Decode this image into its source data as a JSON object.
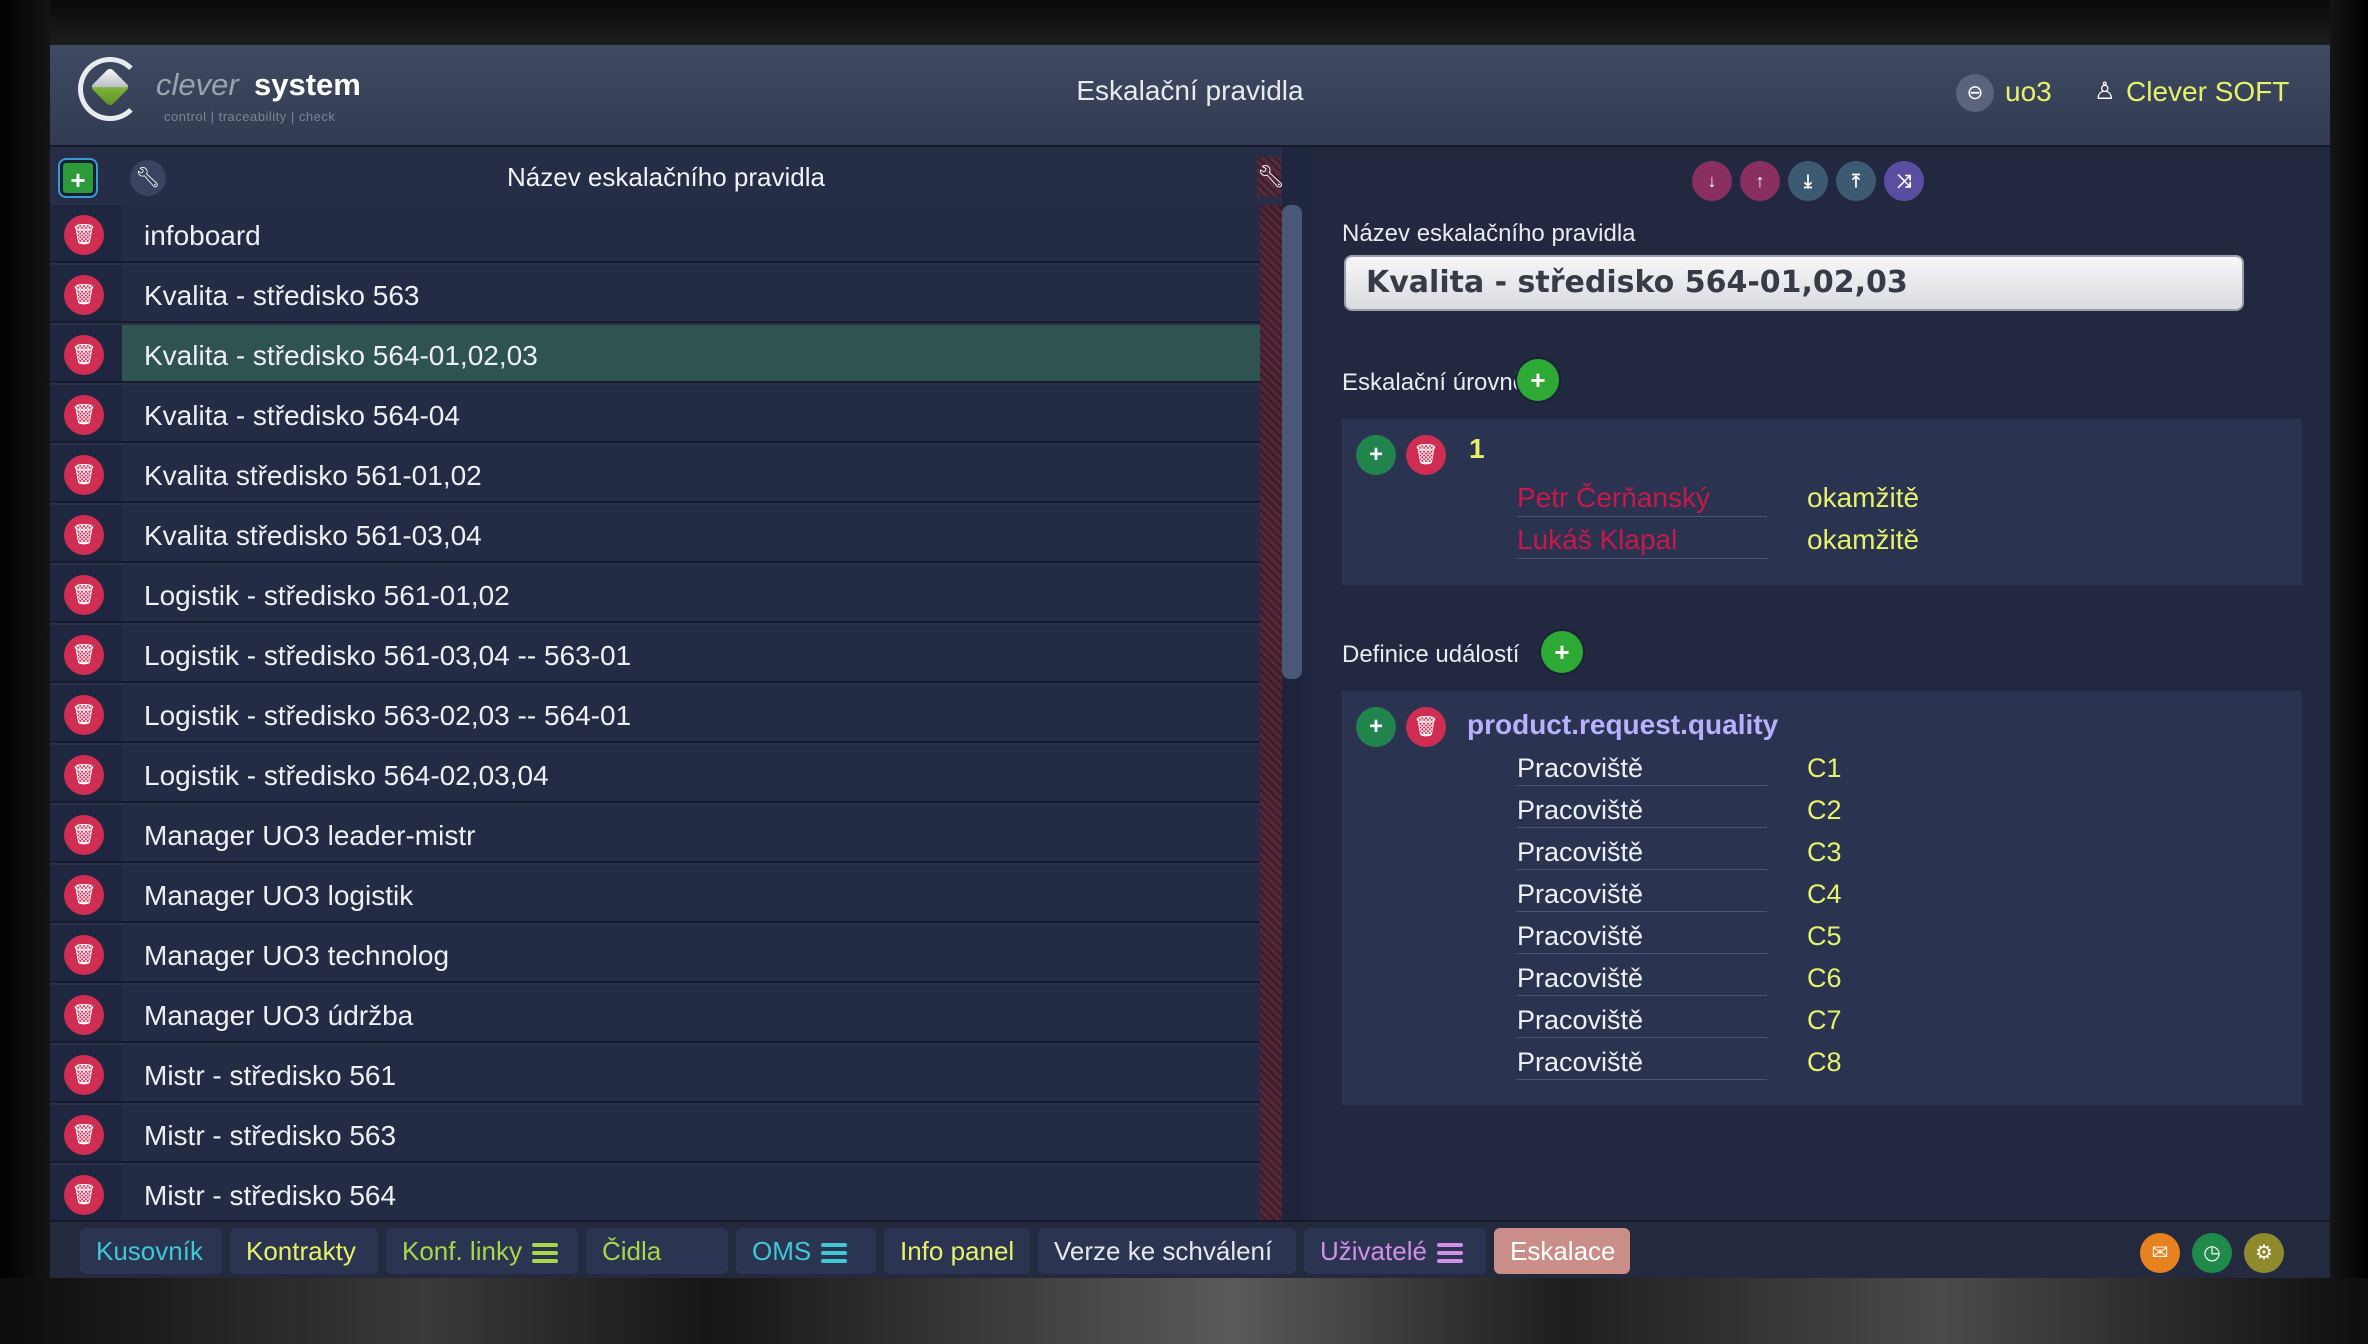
{
  "header": {
    "logo_word_1": "clever",
    "logo_word_2": "system",
    "logo_tagline": "control | traceability | check",
    "title": "Eskalační pravidla",
    "user_code": "uo3",
    "company": "Clever SOFT"
  },
  "list": {
    "title": "Název eskalačního pravidla",
    "selected_index": 2,
    "items": [
      "infoboard",
      "Kvalita - středisko 563",
      "Kvalita - středisko 564-01,02,03",
      "Kvalita - středisko 564-04",
      "Kvalita středisko 561-01,02",
      "Kvalita středisko 561-03,04",
      "Logistik - středisko 561-01,02",
      "Logistik - středisko 561-03,04 -- 563-01",
      "Logistik - středisko 563-02,03 -- 564-01",
      "Logistik - středisko 564-02,03,04",
      "Manager UO3 leader-mistr",
      "Manager UO3 logistik",
      "Manager UO3 technolog",
      "Manager UO3 údržba",
      "Mistr - středisko 561",
      "Mistr - středisko 563",
      "Mistr - středisko 564"
    ]
  },
  "detail": {
    "name_label": "Název eskalačního pravidla",
    "name_value": "Kvalita - středisko 564-01,02,03",
    "levels_label": "Eskalační úrovně",
    "level": {
      "number": "1",
      "people": [
        {
          "name": "Petr Čerňanský",
          "time": "okamžitě"
        },
        {
          "name": "Lukáš Klapal",
          "time": "okamžitě"
        }
      ]
    },
    "events_label": "Definice událostí",
    "event": {
      "name": "product.request.quality",
      "params": [
        {
          "key": "Pracoviště",
          "value": "C1"
        },
        {
          "key": "Pracoviště",
          "value": "C2"
        },
        {
          "key": "Pracoviště",
          "value": "C3"
        },
        {
          "key": "Pracoviště",
          "value": "C4"
        },
        {
          "key": "Pracoviště",
          "value": "C5"
        },
        {
          "key": "Pracoviště",
          "value": "C6"
        },
        {
          "key": "Pracoviště",
          "value": "C7"
        },
        {
          "key": "Pracoviště",
          "value": "C8"
        }
      ]
    },
    "toolbar_icons": [
      "move-down-icon",
      "move-up-icon",
      "move-bottom-icon",
      "move-top-icon",
      "shuffle-icon"
    ]
  },
  "tabs": [
    {
      "label": "Kusovník",
      "color": "#3ec8d8",
      "menu": false
    },
    {
      "label": "Kontrakty",
      "color": "#e6f26a",
      "menu": false
    },
    {
      "label": "Konf. linky",
      "color": "#a8d84a",
      "menu": true
    },
    {
      "label": "Čidla",
      "color": "#a8d84a",
      "menu": false
    },
    {
      "label": "OMS",
      "color": "#3ec8d8",
      "menu": true
    },
    {
      "label": "Info panel",
      "color": "#e6f26a",
      "menu": false
    },
    {
      "label": "Verze ke schválení",
      "color": "#e6e8ee",
      "menu": false
    },
    {
      "label": "Uživatelé",
      "color": "#d38fe8",
      "menu": true
    },
    {
      "label": "Eskalace",
      "color": "#ffffff",
      "menu": false,
      "active": true
    }
  ],
  "colors": {
    "accent_yellow": "#e6f26a",
    "delete_red": "#cf2e52",
    "add_green": "#2fa936",
    "selected_row": "#2f5350",
    "event_violet": "#b9b0ff"
  }
}
